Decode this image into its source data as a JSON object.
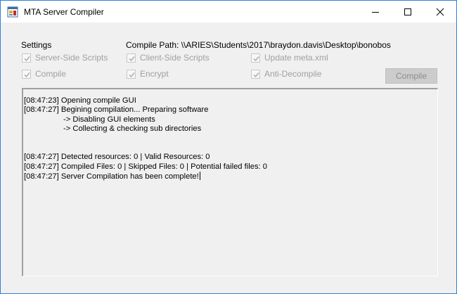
{
  "window": {
    "title": "MTA Server Compiler",
    "icon": "app-icon"
  },
  "settings": {
    "label": "Settings",
    "compile_path_label": "Compile Path:",
    "compile_path_value": "\\\\ARIES\\Students\\2017\\braydon.davis\\Desktop\\bonobos"
  },
  "checkboxes": [
    {
      "label": "Server-Side Scripts",
      "checked": true,
      "enabled": false
    },
    {
      "label": "Client-Side Scripts",
      "checked": true,
      "enabled": false
    },
    {
      "label": "Update meta.xml",
      "checked": true,
      "enabled": false
    },
    {
      "label": "Compile",
      "checked": true,
      "enabled": false
    },
    {
      "label": "Encrypt",
      "checked": true,
      "enabled": false
    },
    {
      "label": "Anti-Decompile",
      "checked": true,
      "enabled": false
    }
  ],
  "compile_button": {
    "label": "Compile",
    "enabled": false
  },
  "log": {
    "lines": [
      {
        "text": "[08:47:23] Opening compile GUI",
        "indent": false
      },
      {
        "text": "[08:47:27] Begining compilation... Preparing software",
        "indent": false
      },
      {
        "text": "-> Disabling GUI elements",
        "indent": true
      },
      {
        "text": "-> Collecting & checking sub directories",
        "indent": true
      },
      {
        "text": "",
        "indent": false
      },
      {
        "text": "",
        "indent": false
      },
      {
        "text": "[08:47:27] Detected resources: 0 | Valid Resources: 0",
        "indent": false
      },
      {
        "text": "[08:47:27] Compiled Files: 0 | Skipped Files: 0 | Potential failed files: 0",
        "indent": false
      },
      {
        "text": "[08:47:27] Server Compilation has been complete!",
        "indent": false
      }
    ]
  },
  "colors": {
    "window_border": "#2b82d9",
    "background": "#f0f0f0",
    "disabled_text": "#a0a0a0"
  }
}
